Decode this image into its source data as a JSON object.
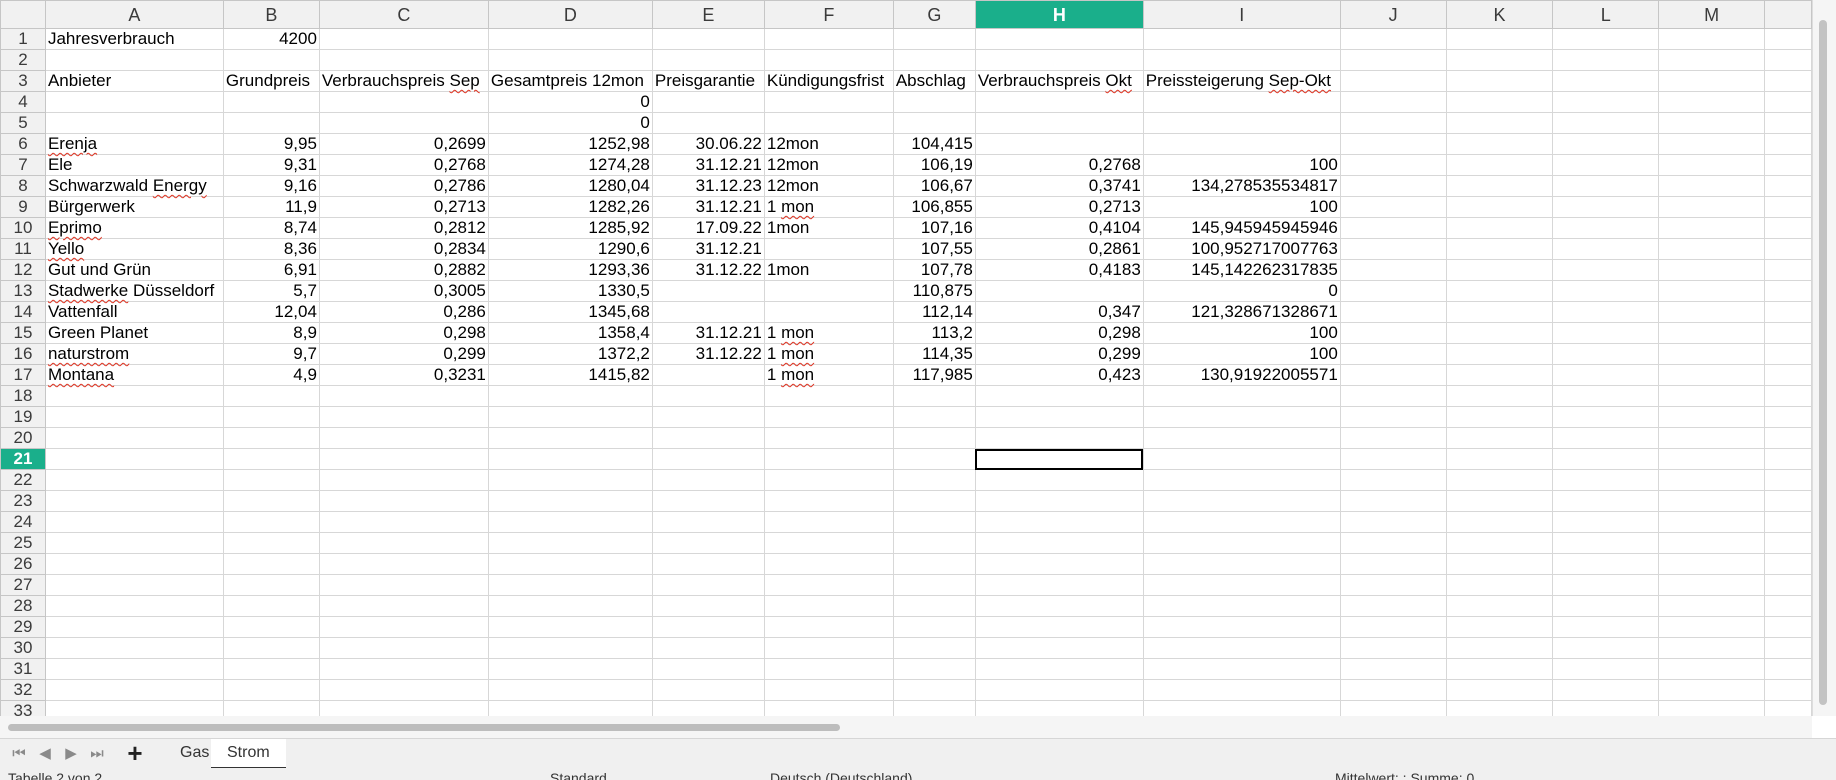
{
  "columns": [
    "A",
    "B",
    "C",
    "D",
    "E",
    "F",
    "G",
    "H",
    "I",
    "J",
    "K",
    "L",
    "M"
  ],
  "selected_column": "H",
  "selected_row": 21,
  "rows": [
    {
      "n": 1,
      "cells": {
        "A": "Jahresverbrauch",
        "B": "4200"
      }
    },
    {
      "n": 2,
      "cells": {}
    },
    {
      "n": 3,
      "cells": {
        "A": "Anbieter",
        "B": "Grundpreis",
        "C": "Verbrauchspreis Sep",
        "D": "Gesamtpreis 12mon",
        "E": "Preisgarantie",
        "F": "Kündigungsfrist",
        "G": "Abschlag",
        "H": "Verbrauchspreis Okt",
        "I": "Preissteigerung Sep-Okt"
      }
    },
    {
      "n": 4,
      "cells": {
        "D": "0"
      }
    },
    {
      "n": 5,
      "cells": {
        "D": "0"
      }
    },
    {
      "n": 6,
      "cells": {
        "A": "Erenja",
        "B": "9,95",
        "C": "0,2699",
        "D": "1252,98",
        "E": "30.06.22",
        "F": "12mon",
        "G": "104,415"
      }
    },
    {
      "n": 7,
      "cells": {
        "A": "Ele",
        "B": "9,31",
        "C": "0,2768",
        "D": "1274,28",
        "E": "31.12.21",
        "F": "12mon",
        "G": "106,19",
        "H": "0,2768",
        "I": "100"
      }
    },
    {
      "n": 8,
      "cells": {
        "A": "Schwarzwald Energy",
        "B": "9,16",
        "C": "0,2786",
        "D": "1280,04",
        "E": "31.12.23",
        "F": "12mon",
        "G": "106,67",
        "H": "0,3741",
        "I": "134,278535534817"
      }
    },
    {
      "n": 9,
      "cells": {
        "A": "Bürgerwerk",
        "B": "11,9",
        "C": "0,2713",
        "D": "1282,26",
        "E": "31.12.21",
        "F": "1 mon",
        "G": "106,855",
        "H": "0,2713",
        "I": "100"
      }
    },
    {
      "n": 10,
      "cells": {
        "A": "Eprimo",
        "B": "8,74",
        "C": "0,2812",
        "D": "1285,92",
        "E": "17.09.22",
        "F": "1mon",
        "G": "107,16",
        "H": "0,4104",
        "I": "145,945945945946"
      }
    },
    {
      "n": 11,
      "cells": {
        "A": "Yello",
        "B": "8,36",
        "C": "0,2834",
        "D": "1290,6",
        "E": "31.12.21",
        "G": "107,55",
        "H": "0,2861",
        "I": "100,952717007763"
      }
    },
    {
      "n": 12,
      "cells": {
        "A": "Gut und Grün",
        "B": "6,91",
        "C": "0,2882",
        "D": "1293,36",
        "E": "31.12.22",
        "F": "1mon",
        "G": "107,78",
        "H": "0,4183",
        "I": "145,142262317835"
      }
    },
    {
      "n": 13,
      "cells": {
        "A": "Stadwerke Düsseldorf",
        "B": "5,7",
        "C": "0,3005",
        "D": "1330,5",
        "G": "110,875",
        "I": "0"
      }
    },
    {
      "n": 14,
      "cells": {
        "A": "Vattenfall",
        "B": "12,04",
        "C": "0,286",
        "D": "1345,68",
        "G": "112,14",
        "H": "0,347",
        "I": "121,328671328671"
      }
    },
    {
      "n": 15,
      "cells": {
        "A": "Green Planet",
        "B": "8,9",
        "C": "0,298",
        "D": "1358,4",
        "E": "31.12.21",
        "F": "1 mon",
        "G": "113,2",
        "H": "0,298",
        "I": "100"
      }
    },
    {
      "n": 16,
      "cells": {
        "A": "naturstrom",
        "B": "9,7",
        "C": "0,299",
        "D": "1372,2",
        "E": "31.12.22",
        "F": "1 mon",
        "G": "114,35",
        "H": "0,299",
        "I": "100"
      }
    },
    {
      "n": 17,
      "cells": {
        "A": "Montana",
        "B": "4,9",
        "C": "0,3231",
        "D": "1415,82",
        "F": "1 mon",
        "G": "117,985",
        "H": "0,423",
        "I": "130,91922005571"
      }
    },
    {
      "n": 18,
      "cells": {}
    },
    {
      "n": 19,
      "cells": {}
    },
    {
      "n": 20,
      "cells": {}
    },
    {
      "n": 21,
      "cells": {}
    },
    {
      "n": 22,
      "cells": {}
    },
    {
      "n": 23,
      "cells": {}
    },
    {
      "n": 24,
      "cells": {}
    },
    {
      "n": 25,
      "cells": {}
    },
    {
      "n": 26,
      "cells": {}
    },
    {
      "n": 27,
      "cells": {}
    },
    {
      "n": 28,
      "cells": {}
    },
    {
      "n": 29,
      "cells": {}
    },
    {
      "n": 30,
      "cells": {}
    },
    {
      "n": 31,
      "cells": {}
    },
    {
      "n": 32,
      "cells": {}
    },
    {
      "n": 33,
      "cells": {}
    }
  ],
  "text_columns": [
    "A",
    "F"
  ],
  "spellcheck_words": [
    "Erenja",
    "Energy",
    "Eprimo",
    "Yello",
    "Stadwerke",
    "naturstrom",
    "Montana",
    "Sep",
    "Okt",
    "Sep-Okt",
    "mon"
  ],
  "sheet_tabs": [
    "Gas",
    "Strom"
  ],
  "active_tab": "Strom",
  "status": {
    "sheet_info": "Tabelle 2 von 2",
    "page_style": "Standard",
    "language": "Deutsch (Deutschland)",
    "summary": "Mittelwert: ; Summe: 0"
  },
  "colors": {
    "selection_header": "#1aaf8b"
  }
}
